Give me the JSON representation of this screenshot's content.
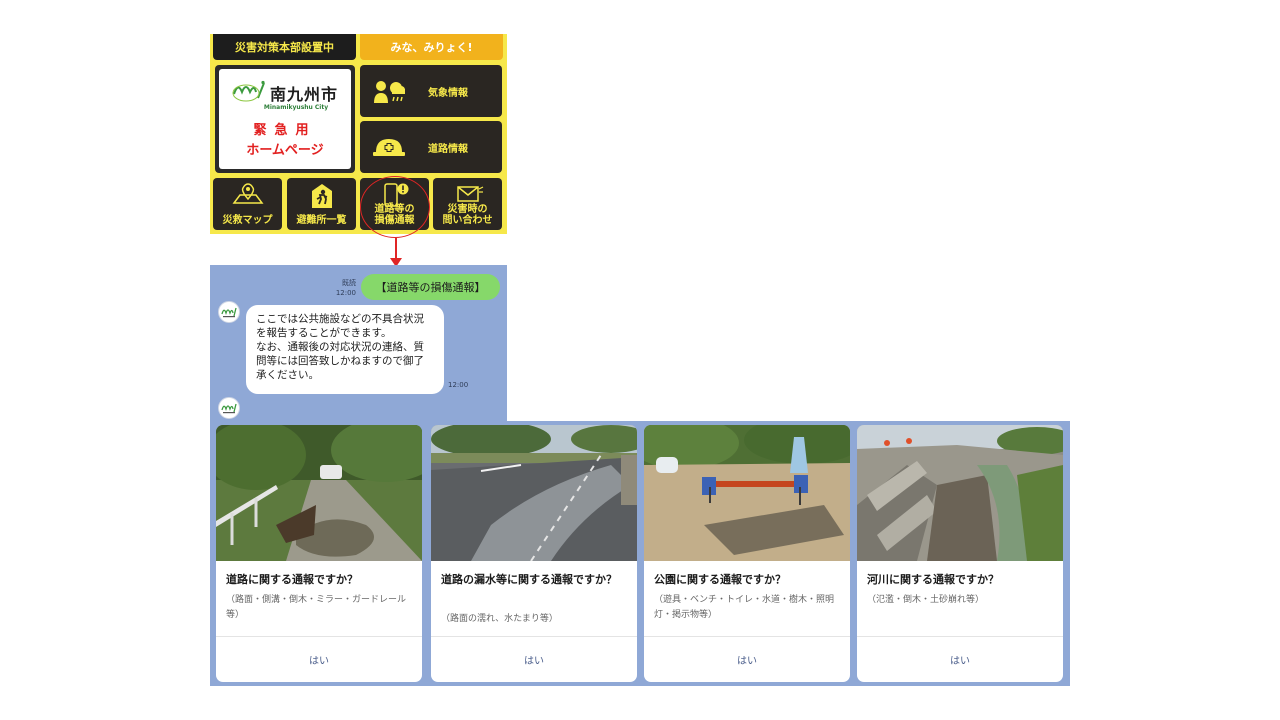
{
  "rich_menu": {
    "header_left": "災害対策本部設置中",
    "header_right": "みな、みりょく!",
    "logo": {
      "city_name": "南九州市",
      "city_roman": "Minamikyushu City",
      "emergency_line1": "緊急用",
      "emergency_line2": "ホームページ"
    },
    "weather": "気象情報",
    "road": "道路情報",
    "buttons": [
      {
        "line1": "災救マップ",
        "line2": "",
        "icon": "map-pin-icon"
      },
      {
        "line1": "避難所一覧",
        "line2": "",
        "icon": "evacuation-icon"
      },
      {
        "line1": "道路等の",
        "line2": "損傷通報",
        "icon": "phone-alert-icon"
      },
      {
        "line1": "災害時の",
        "line2": "問い合わせ",
        "icon": "mail-icon"
      }
    ]
  },
  "chat": {
    "sent": {
      "status": "既読",
      "time": "12:00",
      "text": "【道路等の損傷通報】"
    },
    "received": {
      "text": "ここでは公共施設などの不具合状況を報告することができます。\nなお、通報後の対応状況の連絡、質問等には回答致しかねますので御了承ください。",
      "time": "12:00"
    },
    "colors": {
      "background": "#8fa8d6",
      "sent_bubble": "#86d86a"
    }
  },
  "cards": [
    {
      "title": "道路に関する通報ですか？",
      "desc": "（路面・側溝・倒木・ミラー・ガードレール等）",
      "button": "はい"
    },
    {
      "title": "道路の漏水等に関する通報ですか？",
      "desc": "（路面の濡れ、水たまり等）",
      "button": "はい"
    },
    {
      "title": "公園に関する通報ですか？",
      "desc": "（遊具・ベンチ・トイレ・水道・樹木・照明灯・掲示物等）",
      "button": "はい"
    },
    {
      "title": "河川に関する通報ですか？",
      "desc": "（氾濫・倒木・土砂崩れ等）",
      "button": "はい"
    }
  ]
}
